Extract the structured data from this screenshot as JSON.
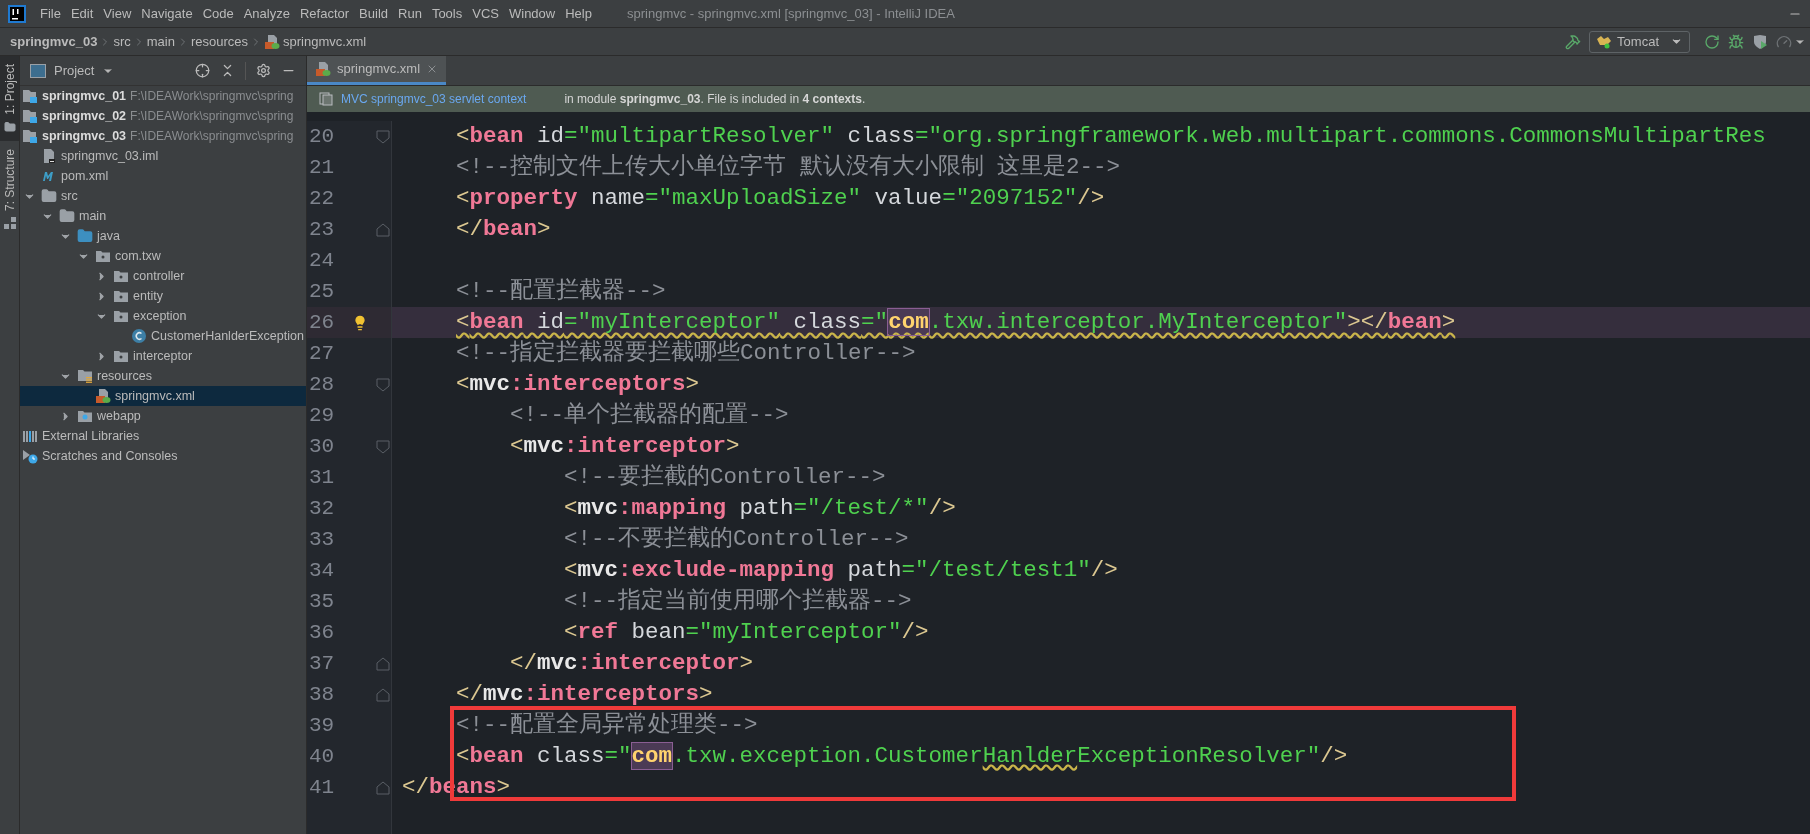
{
  "menu": {
    "items": [
      "File",
      "Edit",
      "View",
      "Navigate",
      "Code",
      "Analyze",
      "Refactor",
      "Build",
      "Run",
      "Tools",
      "VCS",
      "Window",
      "Help"
    ],
    "title": "springmvc - springmvc.xml [springmvc_03] - IntelliJ IDEA"
  },
  "breadcrumbs": [
    "springmvc_03",
    "src",
    "main",
    "resources",
    "springmvc.xml"
  ],
  "run_config": {
    "label": "Tomcat"
  },
  "side_stripe": [
    {
      "label": "1: Project",
      "selected": true
    },
    {
      "label": "7: Structure",
      "selected": false
    }
  ],
  "project_panel": {
    "title": "Project",
    "tree": [
      {
        "kind": "module",
        "label": "springmvc_01",
        "path": "F:\\IDEAWork\\springmvc\\spring",
        "selected": false
      },
      {
        "kind": "module",
        "label": "springmvc_02",
        "path": "F:\\IDEAWork\\springmvc\\spring",
        "selected": false
      },
      {
        "kind": "module",
        "label": "springmvc_03",
        "path": "F:\\IDEAWork\\springmvc\\spring",
        "selected": false
      },
      {
        "kind": "iml",
        "label": "springmvc_03.iml",
        "selected": false
      },
      {
        "kind": "maven",
        "label": "pom.xml",
        "selected": false
      },
      {
        "kind": "folder",
        "label": "src",
        "selected": false,
        "expanded": true,
        "children": [
          {
            "kind": "folder",
            "label": "main",
            "selected": false,
            "expanded": true,
            "children": [
              {
                "kind": "source",
                "label": "java",
                "selected": false,
                "expanded": true,
                "children": [
                  {
                    "kind": "package",
                    "label": "com.txw",
                    "selected": false,
                    "expanded": true,
                    "children": [
                      {
                        "kind": "package",
                        "label": "controller",
                        "selected": false,
                        "expanded": false
                      },
                      {
                        "kind": "package",
                        "label": "entity",
                        "selected": false,
                        "expanded": false
                      },
                      {
                        "kind": "package",
                        "label": "exception",
                        "selected": false,
                        "expanded": true,
                        "children": [
                          {
                            "kind": "class",
                            "label": "CustomerHanlderException",
                            "selected": false
                          }
                        ]
                      },
                      {
                        "kind": "package",
                        "label": "interceptor",
                        "selected": false,
                        "expanded": false
                      }
                    ]
                  }
                ]
              },
              {
                "kind": "resources",
                "label": "resources",
                "selected": false,
                "expanded": true,
                "children": [
                  {
                    "kind": "xml",
                    "label": "springmvc.xml",
                    "selected": true
                  }
                ]
              },
              {
                "kind": "web",
                "label": "webapp",
                "selected": false,
                "expanded": false
              }
            ]
          }
        ]
      },
      {
        "kind": "libraries",
        "label": "External Libraries",
        "selected": false
      },
      {
        "kind": "scratches",
        "label": "Scratches and Consoles",
        "selected": false
      }
    ]
  },
  "editor_tabs": [
    {
      "label": "springmvc.xml",
      "selected": true
    }
  ],
  "info_bar": {
    "link": "MVC springmvc_03 servlet context",
    "text": "in module **springmvc_03**. File is included in **4 contexts**."
  },
  "lines": [
    {
      "number": "20",
      "fold_start": true,
      "tokens": [
        {
          "kind": "punct",
          "text": "<"
        },
        {
          "kind": "tag",
          "text": "bean"
        },
        {
          "kind": "attr",
          "text": " id"
        },
        {
          "kind": "string",
          "text": "=\"multipartResolver\""
        },
        {
          "kind": "attr",
          "text": " class"
        },
        {
          "kind": "string",
          "text": "=\"org.springframework.web.multipart.commons.CommonsMultipartRes"
        }
      ]
    },
    {
      "number": "21",
      "tokens": [
        {
          "kind": "comment",
          "text": "<!--控制文件上传大小单位字节 默认没有大小限制 这里是2-->"
        }
      ]
    },
    {
      "number": "22",
      "tokens": [
        {
          "kind": "punct",
          "text": "<"
        },
        {
          "kind": "tag",
          "text": "property"
        },
        {
          "kind": "attr",
          "text": " name"
        },
        {
          "kind": "string",
          "text": "=\"maxUploadSize\""
        },
        {
          "kind": "attr",
          "text": " value"
        },
        {
          "kind": "string",
          "text": "=\"2097152\""
        },
        {
          "kind": "punct",
          "text": "/>"
        }
      ]
    },
    {
      "number": "23",
      "fold_end": true,
      "tokens": [
        {
          "kind": "punct",
          "text": "</"
        },
        {
          "kind": "tag",
          "text": "bean"
        },
        {
          "kind": "punct",
          "text": ">"
        }
      ]
    },
    {
      "number": "24"
    },
    {
      "number": "25",
      "tokens": [
        {
          "kind": "comment",
          "text": "<!--配置拦截器-->"
        }
      ]
    },
    {
      "number": "26",
      "current": true,
      "bulb": true,
      "warning": true,
      "tokens": [
        {
          "kind": "punct",
          "text": "<"
        },
        {
          "kind": "tag",
          "text": "bean"
        },
        {
          "kind": "attr",
          "text": " id"
        },
        {
          "kind": "string",
          "text": "=\"myInterceptor\""
        },
        {
          "kind": "attr",
          "text": " class"
        },
        {
          "kind": "string",
          "text": "=\""
        },
        {
          "kind": "match",
          "text": "com"
        },
        {
          "kind": "string",
          "text": ".txw.interceptor.MyInterceptor\""
        },
        {
          "kind": "punct",
          "text": "></"
        },
        {
          "kind": "tag",
          "text": "bean"
        },
        {
          "kind": "punct",
          "text": ">"
        }
      ]
    },
    {
      "number": "27",
      "tokens": [
        {
          "kind": "comment",
          "text": "<!--指定拦截器要拦截哪些Controller-->"
        }
      ]
    },
    {
      "number": "28",
      "fold_start": true,
      "tokens": [
        {
          "kind": "punct",
          "text": "<"
        },
        {
          "kind": "ns",
          "text": "mvc"
        },
        {
          "kind": "tag",
          "text": ":interceptors"
        },
        {
          "kind": "punct",
          "text": ">"
        }
      ],
      "children": [
        {
          "number": "29",
          "tokens": [
            {
              "kind": "comment",
              "text": "<!--单个拦截器的配置-->"
            }
          ]
        },
        {
          "number": "30",
          "fold_start": true,
          "tokens": [
            {
              "kind": "punct",
              "text": "<"
            },
            {
              "kind": "ns",
              "text": "mvc"
            },
            {
              "kind": "tag",
              "text": ":interceptor"
            },
            {
              "kind": "punct",
              "text": ">"
            }
          ],
          "children": [
            {
              "number": "31",
              "tokens": [
                {
                  "kind": "comment",
                  "text": "<!--要拦截的Controller-->"
                }
              ]
            },
            {
              "number": "32",
              "tokens": [
                {
                  "kind": "punct",
                  "text": "<"
                },
                {
                  "kind": "ns",
                  "text": "mvc"
                },
                {
                  "kind": "tag",
                  "text": ":mapping"
                },
                {
                  "kind": "attr",
                  "text": " path"
                },
                {
                  "kind": "string",
                  "text": "=\"/test/*\""
                },
                {
                  "kind": "punct",
                  "text": "/>"
                }
              ]
            },
            {
              "number": "33",
              "tokens": [
                {
                  "kind": "comment",
                  "text": "<!--不要拦截的Controller-->"
                }
              ]
            },
            {
              "number": "34",
              "tokens": [
                {
                  "kind": "punct",
                  "text": "<"
                },
                {
                  "kind": "ns",
                  "text": "mvc"
                },
                {
                  "kind": "tag",
                  "text": ":exclude-mapping"
                },
                {
                  "kind": "attr",
                  "text": " path"
                },
                {
                  "kind": "string",
                  "text": "=\"/test/test1\""
                },
                {
                  "kind": "punct",
                  "text": "/>"
                }
              ]
            },
            {
              "number": "35",
              "tokens": [
                {
                  "kind": "comment",
                  "text": "<!--指定当前使用哪个拦截器-->"
                }
              ]
            },
            {
              "number": "36",
              "tokens": [
                {
                  "kind": "punct",
                  "text": "<"
                },
                {
                  "kind": "tag",
                  "text": "ref"
                },
                {
                  "kind": "attr",
                  "text": " bean"
                },
                {
                  "kind": "string",
                  "text": "=\"myInterceptor\""
                },
                {
                  "kind": "punct",
                  "text": "/>"
                }
              ]
            }
          ]
        },
        {
          "number": "37",
          "fold_end": true,
          "tokens": [
            {
              "kind": "punct",
              "text": "</"
            },
            {
              "kind": "ns",
              "text": "mvc"
            },
            {
              "kind": "tag",
              "text": ":interceptor"
            },
            {
              "kind": "punct",
              "text": ">"
            }
          ]
        }
      ]
    },
    {
      "number": "38",
      "fold_end": true,
      "tokens": [
        {
          "kind": "punct",
          "text": "</"
        },
        {
          "kind": "ns",
          "text": "mvc"
        },
        {
          "kind": "tag",
          "text": ":interceptors"
        },
        {
          "kind": "punct",
          "text": ">"
        }
      ]
    },
    {
      "number": "39",
      "boxed": true,
      "tokens": [
        {
          "kind": "comment",
          "text": "<!--配置全局异常处理类-->"
        }
      ]
    },
    {
      "number": "40",
      "boxed": true,
      "tokens": [
        {
          "kind": "punct",
          "text": "<"
        },
        {
          "kind": "tag",
          "text": "bean"
        },
        {
          "kind": "attr",
          "text": " class"
        },
        {
          "kind": "string",
          "text": "=\""
        },
        {
          "kind": "match",
          "text": "com"
        },
        {
          "kind": "string",
          "text": ".txw.exception.Customer"
        },
        {
          "kind": "typo",
          "text": "Hanlder"
        },
        {
          "kind": "string",
          "text": "ExceptionResolver\""
        },
        {
          "kind": "punct",
          "text": "/>"
        }
      ]
    },
    {
      "number": "41",
      "fold_end": true,
      "boxed": true,
      "dedent": true,
      "tokens": [
        {
          "kind": "punct",
          "text": "</"
        },
        {
          "kind": "tag",
          "text": "beans"
        },
        {
          "kind": "punct",
          "text": ">"
        }
      ]
    }
  ]
}
